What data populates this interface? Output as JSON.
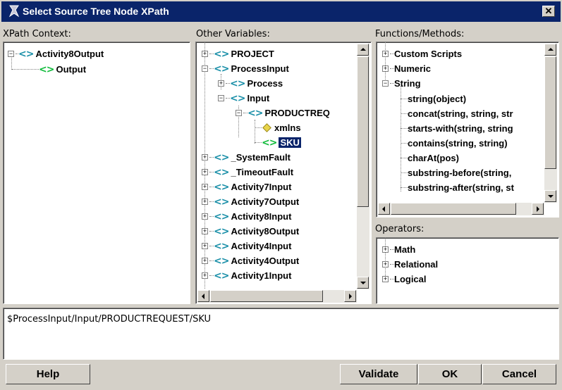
{
  "window": {
    "title": "Select Source Tree Node XPath",
    "close_glyph": "✕"
  },
  "panels": {
    "xpath_context_label": "XPath Context:",
    "other_variables_label": "Other Variables:",
    "functions_label": "Functions/Methods:",
    "operators_label": "Operators:"
  },
  "context_tree": [
    {
      "label": "Activity8Output",
      "expander": "⊟",
      "icon": "element-tag-blue"
    },
    {
      "label": "Output",
      "icon": "element-tag-green"
    }
  ],
  "variables_tree": [
    {
      "label": "PROJECT",
      "expander": "+"
    },
    {
      "label": "ProcessInput",
      "expander": "−"
    },
    {
      "label": "Process",
      "expander": "+"
    },
    {
      "label": "Input",
      "expander": "−"
    },
    {
      "label": "PRODUCTREQ",
      "expander": "−"
    },
    {
      "label": "xmlns",
      "icon": "attribute-diamond"
    },
    {
      "label": "SKU",
      "icon": "element-tag-green",
      "selected": true
    },
    {
      "label": "_SystemFault",
      "expander": "+"
    },
    {
      "label": "_TimeoutFault",
      "expander": "+"
    },
    {
      "label": "Activity7Input",
      "expander": "+"
    },
    {
      "label": "Activity7Output",
      "expander": "+"
    },
    {
      "label": "Activity8Input",
      "expander": "+"
    },
    {
      "label": "Activity8Output",
      "expander": "+"
    },
    {
      "label": "Activity4Input",
      "expander": "+"
    },
    {
      "label": "Activity4Output",
      "expander": "+"
    },
    {
      "label": "Activity1Input",
      "expander": "+"
    }
  ],
  "functions_tree": [
    {
      "label": "Custom Scripts",
      "expander": "+"
    },
    {
      "label": "Numeric",
      "expander": "+"
    },
    {
      "label": "String",
      "expander": "−"
    },
    {
      "label": "string(object)"
    },
    {
      "label": "concat(string, string, str"
    },
    {
      "label": "starts-with(string, string"
    },
    {
      "label": "contains(string, string)"
    },
    {
      "label": "charAt(pos)"
    },
    {
      "label": "substring-before(string,"
    },
    {
      "label": "substring-after(string, st"
    }
  ],
  "operators_tree": [
    {
      "label": "Math",
      "expander": "+"
    },
    {
      "label": "Relational",
      "expander": "+"
    },
    {
      "label": "Logical",
      "expander": "+"
    }
  ],
  "expression": {
    "value": "$ProcessInput/Input/PRODUCTREQUEST/SKU"
  },
  "buttons": {
    "help": "Help",
    "validate": "Validate",
    "ok": "OK",
    "cancel": "Cancel"
  }
}
